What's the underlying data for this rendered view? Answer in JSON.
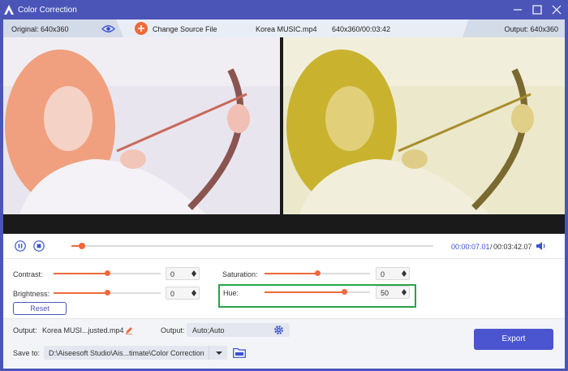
{
  "window": {
    "title": "Color Correction"
  },
  "infobar": {
    "original_label": "Original: 640x360",
    "change_source_label": "Change Source File",
    "file_name": "Korea MUSIC.mp4",
    "file_meta": "640x360/00:03:42",
    "output_label": "Output: 640x360"
  },
  "controls": {
    "current_time": "00:00:07.01",
    "separator": "/",
    "total_time": "00:03:42.07",
    "progress": 0.03
  },
  "adjustments": {
    "contrast": {
      "label": "Contrast:",
      "value": "0",
      "level": 0.5
    },
    "saturation": {
      "label": "Saturation:",
      "value": "0",
      "level": 0.5
    },
    "brightness": {
      "label": "Brightness:",
      "value": "0",
      "level": 0.5
    },
    "hue": {
      "label": "Hue:",
      "value": "50",
      "level": 0.75
    },
    "reset_label": "Reset"
  },
  "footer": {
    "output_label": "Output:",
    "output_file": "Korea MUSI...justed.mp4",
    "format_label": "Output:",
    "format_value": "Auto;Auto",
    "save_to_label": "Save to:",
    "save_path": "D:\\Aiseesoft Studio\\Ais...timate\\Color Correction",
    "export_label": "Export"
  },
  "colors": {
    "accent": "#f06a3a",
    "brand": "#4b55b8",
    "export": "#4b55d0",
    "highlight_border": "#29a34a"
  },
  "icons": [
    "app-logo-icon",
    "minimize-icon",
    "maximize-icon",
    "close-icon",
    "eye-icon",
    "add-icon",
    "pause-icon",
    "stop-icon",
    "volume-icon",
    "edit-icon",
    "gear-icon",
    "folder-icon"
  ]
}
